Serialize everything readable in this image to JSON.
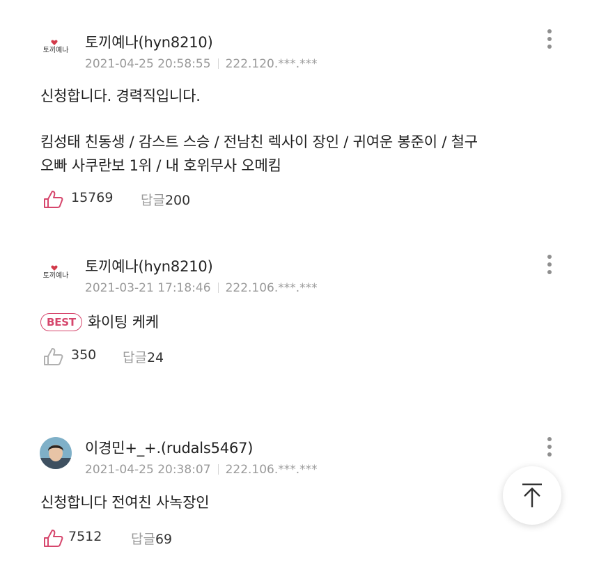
{
  "comments": [
    {
      "nickname": "토끼예나(hyn8210)",
      "date": "2021-04-25 20:58:55",
      "ip": "222.120.***.***",
      "lines": [
        "신청합니다.  경력직입니다.",
        "킴성태 친동생 / 감스트 스승 / 전남친 렉사이 장인 / 귀여운 봉준이 / 철구",
        "오빠 사쿠란보 1위 / 내 호위무사 오메킴"
      ],
      "likes": "15769",
      "reply_label": "답글",
      "reply_count": "200",
      "avatar_icon": "rabbit-logo-avatar"
    },
    {
      "nickname": "토끼예나(hyn8210)",
      "date": "2021-03-21 17:18:46",
      "ip": "222.106.***.***",
      "badge": "BEST",
      "text": "화이팅 케케",
      "likes": "350",
      "reply_label": "답글",
      "reply_count": "24",
      "avatar_icon": "rabbit-logo-avatar"
    },
    {
      "nickname": "이경민+_+.(rudals5467)",
      "date": "2021-04-25 20:38:07",
      "ip": "222.106.***.***",
      "text": "신청합니다 전여친 사녹장인",
      "likes": "7512",
      "reply_label": "답글",
      "reply_count": "69",
      "avatar_icon": "photo-avatar"
    }
  ],
  "colors": {
    "accent": "#d6466c",
    "meta_gray": "#9a9a9a"
  },
  "icons": {
    "like": "thumbs-up-icon",
    "more": "more-vertical-icon",
    "scroll_top": "arrow-up-icon"
  }
}
